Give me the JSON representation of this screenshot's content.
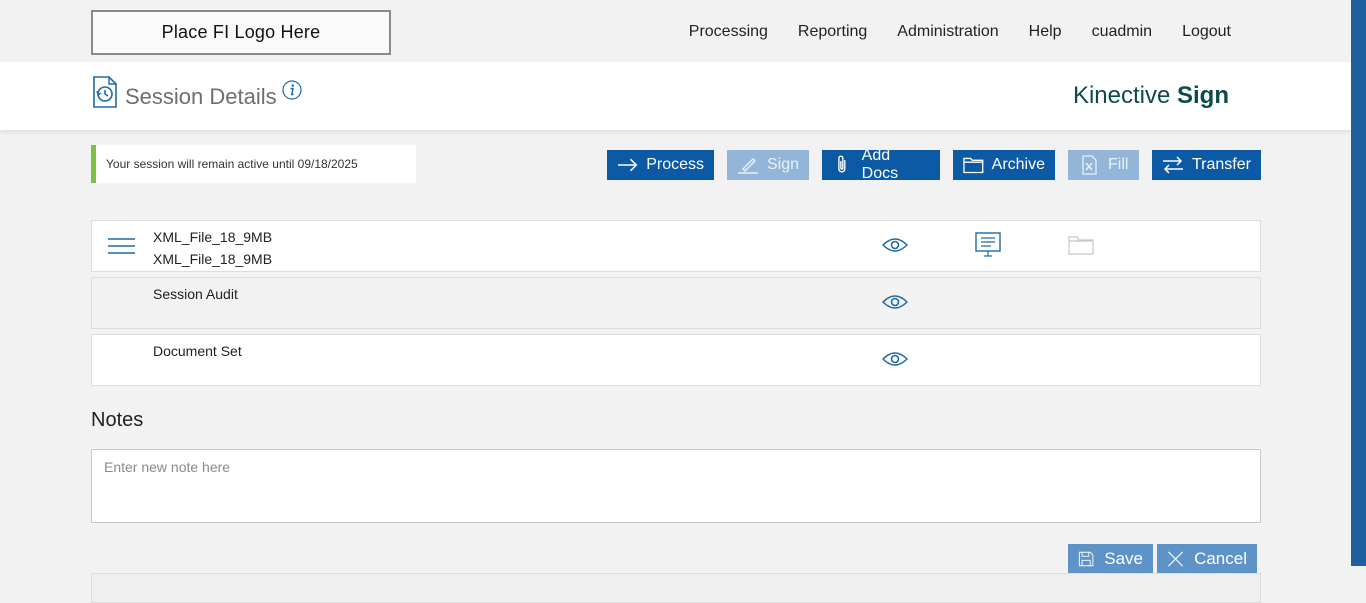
{
  "header": {
    "logo_text": "Place FI Logo Here",
    "nav": [
      "Processing",
      "Reporting",
      "Administration",
      "Help",
      "cuadmin",
      "Logout"
    ]
  },
  "subheader": {
    "title": "Session Details",
    "brand_light": "Kinective ",
    "brand_bold": "Sign"
  },
  "session_message": "Your session will remain active until 09/18/2025",
  "actions": [
    {
      "label": "Process",
      "icon": "arrow-right-icon",
      "enabled": true
    },
    {
      "label": "Sign",
      "icon": "pen-icon",
      "enabled": false
    },
    {
      "label": "Add Docs",
      "icon": "paperclip-icon",
      "enabled": true
    },
    {
      "label": "Archive",
      "icon": "folder-icon",
      "enabled": true
    },
    {
      "label": "Fill",
      "icon": "excel-file-icon",
      "enabled": false
    },
    {
      "label": "Transfer",
      "icon": "transfer-arrows-icon",
      "enabled": true
    }
  ],
  "documents": [
    {
      "lines": [
        "XML_File_18_9MB",
        "XML_File_18_9MB"
      ]
    },
    {
      "lines": [
        "Session Audit"
      ]
    },
    {
      "lines": [
        "Document Set"
      ]
    }
  ],
  "notes": {
    "label": "Notes",
    "placeholder": "Enter new note here"
  },
  "buttons": {
    "save": "Save",
    "cancel": "Cancel"
  },
  "colors": {
    "primary": "#0c5aa6",
    "disabled": "#93b6d8",
    "accent_green": "#7dc142",
    "brand": "#0d4a4a"
  }
}
